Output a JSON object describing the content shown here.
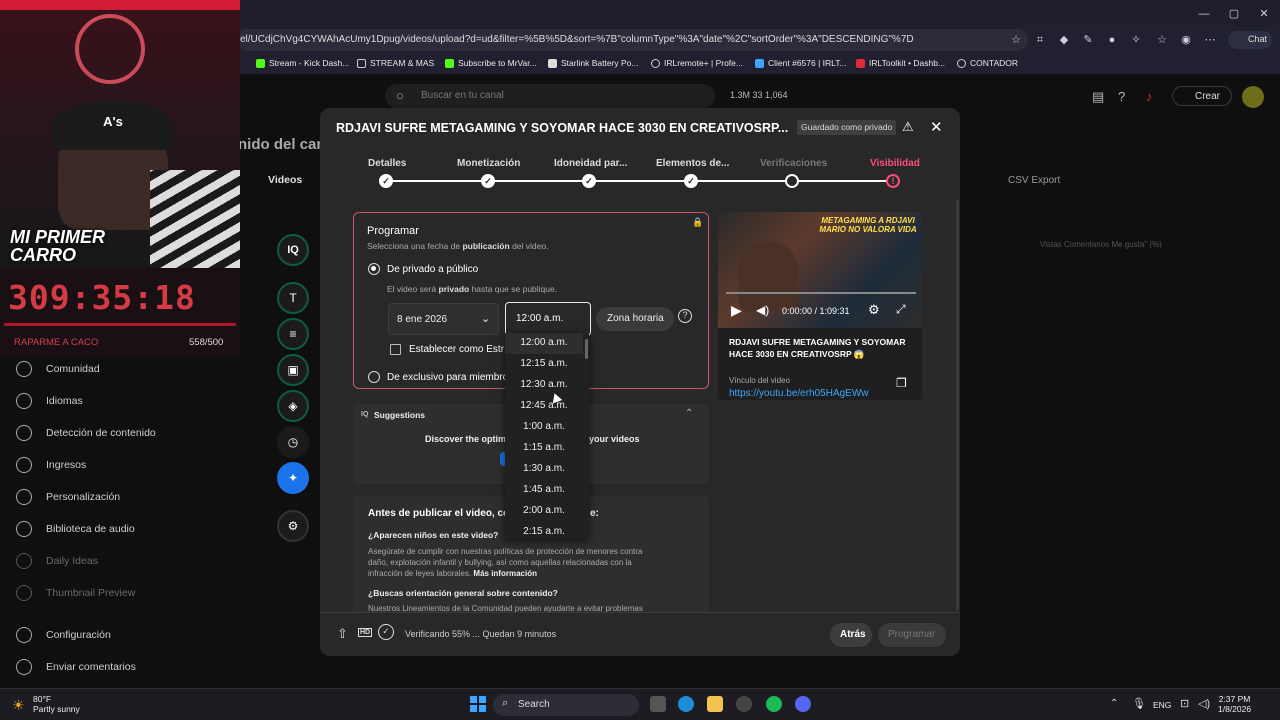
{
  "browser": {
    "url": "el/UCdjChVg4CYWAhAcUmy1Dpug/videos/upload?d=ud&filter=%5B%5D&sort=%7B\"columnType\"%3A\"date\"%2C\"sortOrder\"%3A\"DESCENDING\"%7D",
    "copilot_label": "Chat",
    "bookmarks": [
      "Stream - Kick Dash...",
      "STREAM & MAS",
      "Subscribe to MrVar...",
      "Starlink Battery Po...",
      "IRLremote+ | Profe...",
      "Client #6576 | IRLT...",
      "IRLToolkit • Dashb...",
      "CONTADOR"
    ]
  },
  "studio": {
    "search_placeholder": "Buscar en tu canal",
    "stats": "1.3M   33   1,064",
    "create_label": "Crear",
    "bg_title": "nido del cana",
    "bg_tab": "Videos",
    "bg_tab_prefix": "n",
    "csv_label": "CSV Export",
    "bg_cols": "Vistas     Comentarios     Me gusta\" (%)",
    "nav": [
      {
        "label": "Comunidad",
        "dim": false
      },
      {
        "label": "Idiomas",
        "dim": false
      },
      {
        "label": "Detección de contenido",
        "dim": false
      },
      {
        "label": "Ingresos",
        "dim": false
      },
      {
        "label": "Personalización",
        "dim": false
      },
      {
        "label": "Biblioteca de audio",
        "dim": false
      },
      {
        "label": "Daily Ideas",
        "dim": true
      },
      {
        "label": "Thumbnail Preview",
        "dim": true
      },
      {
        "label": "Configuración",
        "dim": false
      },
      {
        "label": "Enviar comentarios",
        "dim": false
      }
    ],
    "tools": [
      "IQ",
      "T",
      "≡",
      "▣",
      "◈",
      "◷",
      "✦",
      "⚙"
    ]
  },
  "overlay": {
    "cap_text": "A's",
    "banner": "MI PRIMER CARRO",
    "timer": "309:35:18",
    "left_label": "RAPARME A CACO",
    "count": "558/500"
  },
  "modal": {
    "title": "RDJAVI SUFRE METAGAMING Y SOYOMAR HACE 3030 EN CREATIVOSRP...",
    "saved_badge": "Guardado como privado",
    "steps": [
      "Detalles",
      "Monetización",
      "Idoneidad par...",
      "Elementos de...",
      "Verificaciones",
      "Visibilidad"
    ],
    "schedule": {
      "heading": "Programar",
      "subtitle_prefix": "Selecciona una fecha de ",
      "subtitle_bold": "publicación",
      "subtitle_suffix": " del video.",
      "option1": "De privado a público",
      "option1_note_prefix": "El video será ",
      "option1_note_bold": "privado",
      "option1_note_suffix": " hasta que se publique.",
      "date": "8 ene 2026",
      "time": "12:00 a.m.",
      "timezone": "Zona horaria",
      "premiere_checkbox": "Establecer como Estr",
      "option2": "De exclusivo para miembro"
    },
    "suggestions": {
      "title": "Suggestions",
      "text_left": "Discover the optim",
      "text_right": "your videos"
    },
    "before": {
      "heading": "Antes de publicar el video, con",
      "heading_tail": "e:",
      "q1": "¿Aparecen niños en este video?",
      "p1": "Asegúrate de cumplir con nuestras políticas de protección de menores contra daño, explotación infantil y bullying, así como aquellas relacionadas con la infracción de leyes laborales.",
      "p1_link": "Más información",
      "q2": "¿Buscas orientación general sobre contenido?",
      "p2": "Nuestros Lineamientos de la Comunidad pueden ayudarte a evitar problemas"
    },
    "preview": {
      "thumb_text": "METAGAMING A RDJAVI MARIO NO VALORA VIDA",
      "time": "0:00:00 / 1:09:31",
      "video_title": "RDJAVI SUFRE METAGAMING Y SOYOMAR HACE 3030 EN CREATIVOSRP 😱",
      "link_label": "Vínculo del video",
      "link": "https://youtu.be/erh05HAgEWw"
    },
    "footer": {
      "status": "Verificando 55% ... Quedan 9 minutos",
      "back": "Atrás",
      "schedule": "Programar"
    }
  },
  "time_options": [
    "12:00 a.m.",
    "12:15 a.m.",
    "12:30 a.m.",
    "12:45 a.m.",
    "1:00 a.m.",
    "1:15 a.m.",
    "1:30 a.m.",
    "1:45 a.m.",
    "2:00 a.m.",
    "2:15 a.m."
  ],
  "taskbar": {
    "weather_temp": "80°F",
    "weather_desc": "Partly sunny",
    "search": "Search",
    "lang": "ENG",
    "time": "2:37 PM",
    "date": "1/8/2026"
  },
  "colors": {
    "accent_red": "#d31b35",
    "error_pink": "#ff4e7a",
    "link_blue": "#3ea6ff",
    "progress_green": "#0b5d3b"
  }
}
